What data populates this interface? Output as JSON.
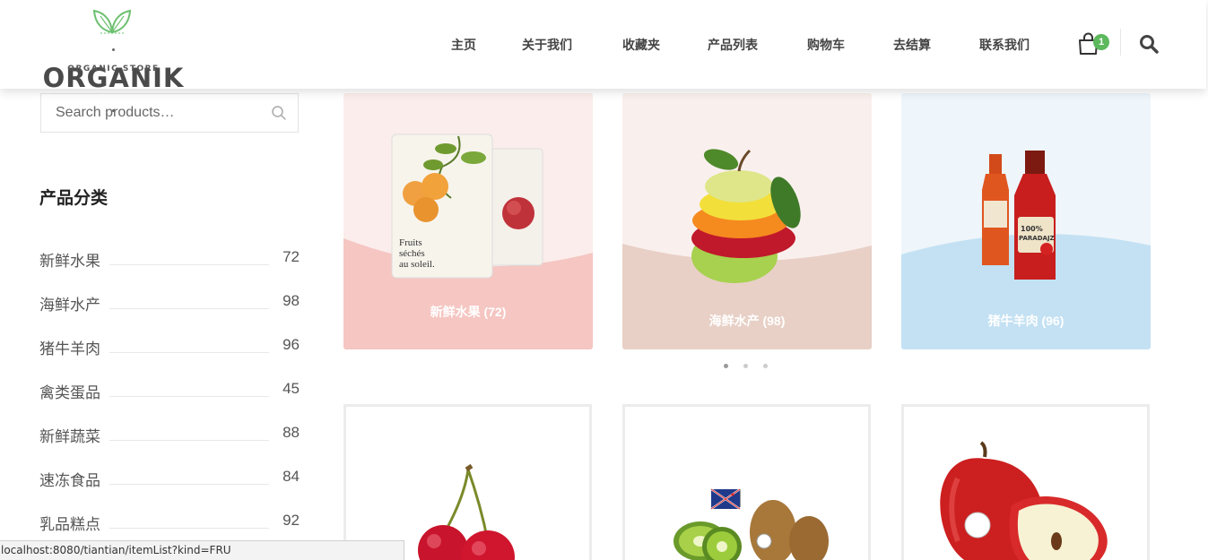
{
  "brand": {
    "name": "ORGANIK",
    "tagline": "ORGANIC STORE"
  },
  "nav": {
    "items": [
      "主页",
      "关于我们",
      "收藏夹",
      "产品列表",
      "购物车",
      "去结算",
      "联系我们"
    ],
    "cart_count": "1"
  },
  "search": {
    "placeholder": "Search products…"
  },
  "sidebar": {
    "title": "产品分类",
    "categories": [
      {
        "name": "新鲜水果",
        "count": "72"
      },
      {
        "name": "海鲜水产",
        "count": "98"
      },
      {
        "name": "猪牛羊肉",
        "count": "96"
      },
      {
        "name": "禽类蛋品",
        "count": "45"
      },
      {
        "name": "新鲜蔬菜",
        "count": "88"
      },
      {
        "name": "速冻食品",
        "count": "84"
      },
      {
        "name": "乳品糕点",
        "count": "92"
      }
    ]
  },
  "category_cards": [
    {
      "label": "新鲜水果 (72)",
      "colors": {
        "top": "#fbedec",
        "bottom": "#f5c6c2"
      }
    },
    {
      "label": "海鲜水产 (98)",
      "colors": {
        "top": "#f9f0ee",
        "bottom": "#e8d0c6"
      }
    },
    {
      "label": "猪牛羊肉 (96)",
      "colors": {
        "top": "#eef5fb",
        "bottom": "#c3e1f3"
      }
    }
  ],
  "carousel": {
    "active_index": 0,
    "count": 3
  },
  "accent_color": "#5cb85c",
  "status_bar": {
    "url": "localhost:8080/tiantian/itemList?kind=FRU"
  }
}
